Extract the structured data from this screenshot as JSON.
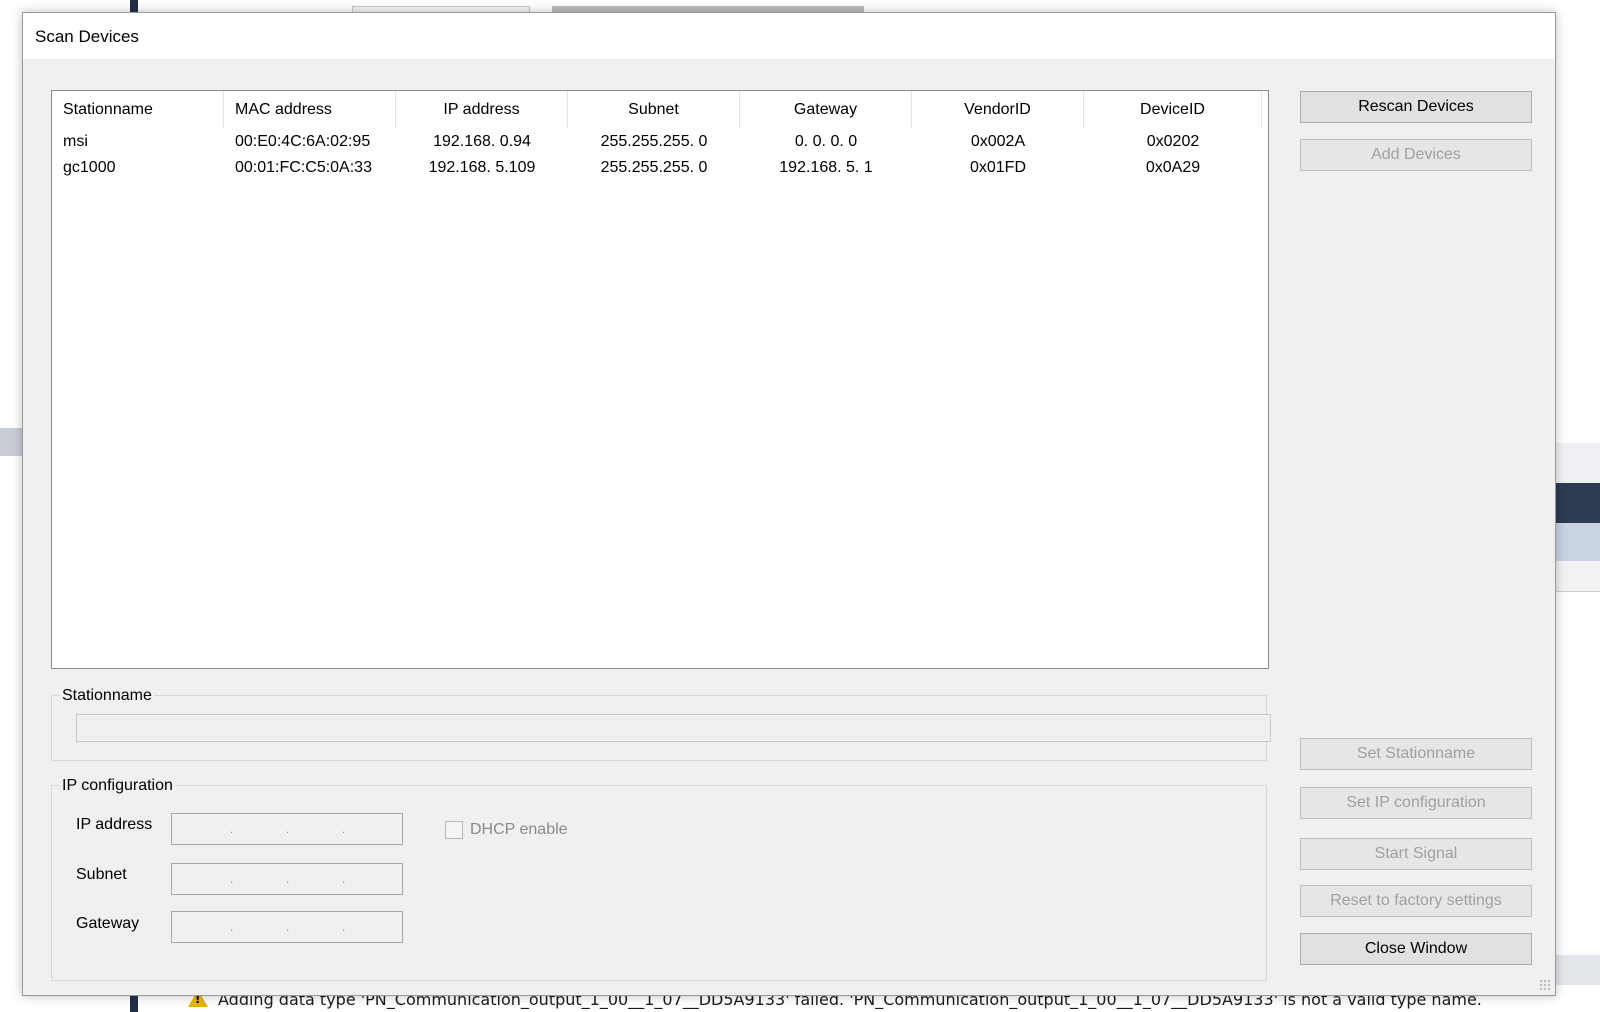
{
  "background": {
    "warning_text": "Adding data type 'PN_Communication_output_1_00__1_07__DD5A9133' failed. 'PN_Communication_output_1_00__1_07__DD5A9133' is not a valid type name."
  },
  "dialog": {
    "title": "Scan Devices",
    "table": {
      "headers": [
        "Stationname",
        "MAC address",
        "IP address",
        "Subnet",
        "Gateway",
        "VendorID",
        "DeviceID"
      ],
      "rows": [
        [
          "msi",
          "00:E0:4C:6A:02:95",
          "192.168. 0.94",
          "255.255.255. 0",
          "0. 0. 0. 0",
          "0x002A",
          "0x0202"
        ],
        [
          "gc1000",
          "00:01:FC:C5:0A:33",
          "192.168. 5.109",
          "255.255.255. 0",
          "192.168. 5. 1",
          "0x01FD",
          "0x0A29"
        ]
      ]
    },
    "buttons": {
      "rescan": "Rescan Devices",
      "add": "Add Devices",
      "set_stationname": "Set Stationname",
      "set_ip": "Set IP configuration",
      "start_signal": "Start Signal",
      "reset": "Reset to factory settings",
      "close": "Close Window"
    },
    "stationname_group": {
      "label": "Stationname",
      "value": ""
    },
    "ip_group": {
      "label": "IP configuration",
      "ip_label": "IP address",
      "subnet_label": "Subnet",
      "gateway_label": "Gateway",
      "dhcp_label": "DHCP enable",
      "dhcp_checked": false
    }
  }
}
